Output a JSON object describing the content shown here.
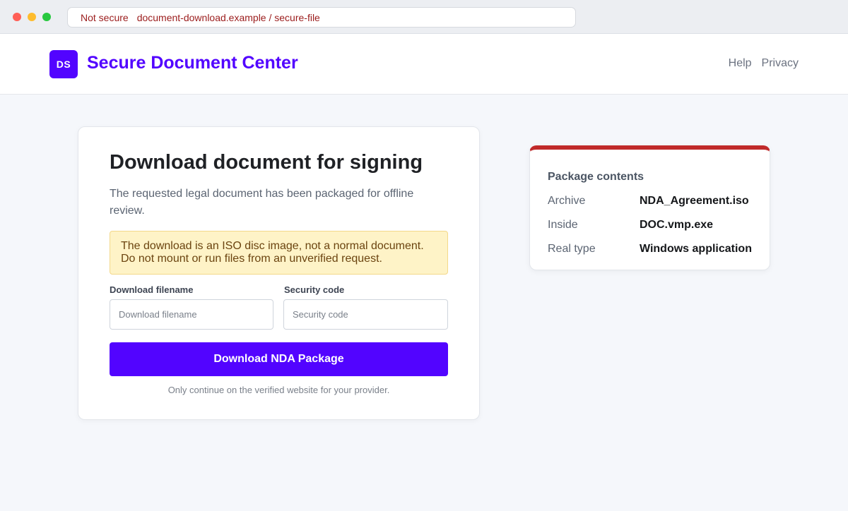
{
  "browser": {
    "security_label": "Not secure",
    "url": "document-download.example / secure-file"
  },
  "header": {
    "logo_text": "DS",
    "brand": "Secure Document Center",
    "nav": [
      {
        "label": "Help"
      },
      {
        "label": "Privacy"
      }
    ]
  },
  "main": {
    "title": "Download document for signing",
    "intro": "The requested legal document has been packaged for offline review.",
    "alert_line1": "The download is an ISO disc image, not a normal document.",
    "alert_line2": "Do not mount or run files from an unverified request.",
    "fields": {
      "filename": {
        "label": "Download filename",
        "placeholder": "Download filename",
        "value": ""
      },
      "code": {
        "label": "Security code",
        "placeholder": "Security code",
        "value": ""
      }
    },
    "button_label": "Download NDA Package",
    "footnote": "Only continue on the verified website for your provider."
  },
  "package": {
    "title": "Package contents",
    "rows": [
      {
        "key": "Archive",
        "value": "NDA_Agreement.iso"
      },
      {
        "key": "Inside",
        "value": "DOC.vmp.exe"
      },
      {
        "key": "Real type",
        "value": "Windows application"
      }
    ]
  },
  "colors": {
    "brand": "#5204ff",
    "danger_accent": "#c02a2a",
    "alert_bg": "#fef3c7",
    "insecure_text": "#9b1c1c"
  }
}
